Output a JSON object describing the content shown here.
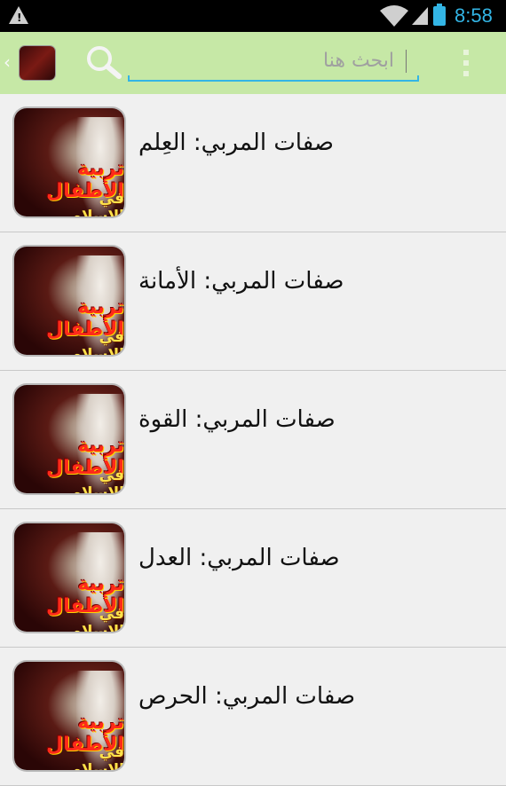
{
  "status_bar": {
    "time": "8:58",
    "warning_glyph": "!",
    "icons": [
      "warning-icon",
      "wifi-icon",
      "signal-icon",
      "battery-icon"
    ],
    "accent_color": "#33b5e5"
  },
  "action_bar": {
    "background_color": "#c6e8a6",
    "back_glyph": "‹",
    "search_placeholder": "ابحث هنا",
    "search_value": "",
    "icons": [
      "back-chevron-icon",
      "app-icon",
      "search-icon",
      "overflow-menu-icon"
    ]
  },
  "thumbnail": {
    "line1": "تربية الأطفال",
    "line2": "في الإسلام"
  },
  "list": {
    "items": [
      {
        "title": "صفات المربي: العِلم"
      },
      {
        "title": "صفات المربي: الأمانة"
      },
      {
        "title": "صفات المربي: القوة"
      },
      {
        "title": "صفات المربي: العدل"
      },
      {
        "title": "صفات المربي: الحرص"
      }
    ]
  }
}
